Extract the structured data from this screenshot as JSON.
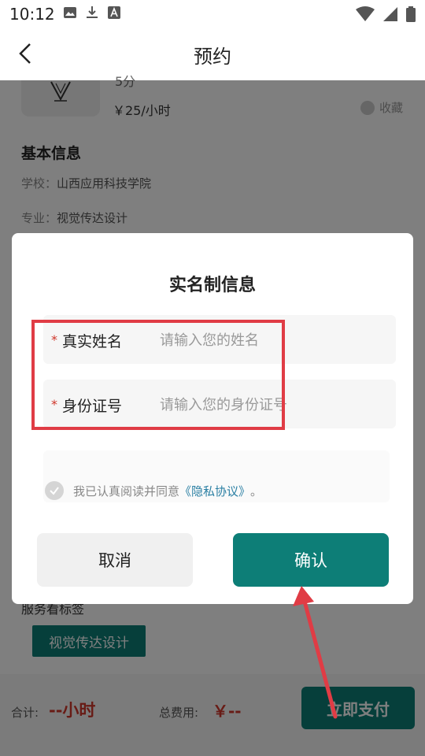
{
  "status_bar": {
    "time": "10:12"
  },
  "nav": {
    "title": "预约"
  },
  "page": {
    "rating": "5分",
    "price": "￥25/小时",
    "fav_label": "收藏",
    "section_title": "基本信息",
    "school_label": "学校：",
    "school_value": "山西应用科技学院",
    "major_label": "专业：",
    "major_value": "视觉传达设计",
    "service_label": "服务看标签",
    "service_tag": "视觉传达设计"
  },
  "bottom": {
    "total_label": "合计:",
    "total_value": "--小时",
    "fee_label": "总费用:",
    "fee_value": "￥--",
    "pay_label": "立即支付"
  },
  "dialog": {
    "title": "实名制信息",
    "name_label": "真实姓名",
    "name_placeholder": "请输入您的姓名",
    "name_value": "",
    "id_label": "身份证号",
    "id_placeholder": "请输入您的身份证号",
    "id_value": "",
    "required_mark": "*",
    "agree_text": "我已认真阅读并同意",
    "agree_link": "《隐私协议》",
    "agree_end": "。",
    "cancel_label": "取消",
    "confirm_label": "确认"
  },
  "colors": {
    "accent": "#0d7e77",
    "price_red": "#d0362b",
    "annotation_red": "#e03c45",
    "link": "#2a7fa3"
  },
  "icons": [
    "image-icon",
    "download-icon",
    "font-icon",
    "wifi-icon",
    "signal-icon",
    "battery-icon",
    "back-arrow-icon",
    "check-icon",
    "favorite-icon"
  ]
}
